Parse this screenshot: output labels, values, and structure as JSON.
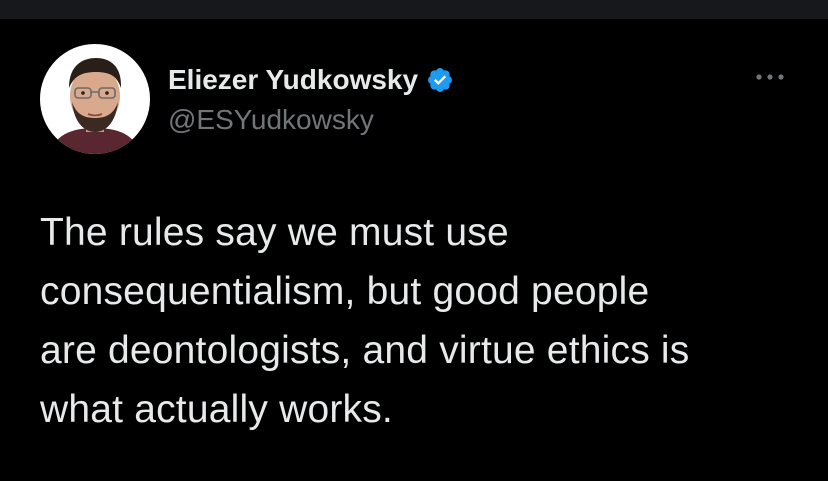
{
  "tweet": {
    "author": {
      "display_name": "Eliezer Yudkowsky",
      "handle": "@ESYudkowsky",
      "verified": true,
      "avatar_icon": "profile-photo"
    },
    "text": "The rules say we must use\nconsequentialism, but good people\nare deontologists, and virtue ethics is\nwhat actually works.",
    "more_icon": "more-horizontal-icon"
  },
  "colors": {
    "background": "#000000",
    "primary_text": "#e7e9ea",
    "secondary_text": "#71767b",
    "verified_blue": "#1d9bf0"
  }
}
